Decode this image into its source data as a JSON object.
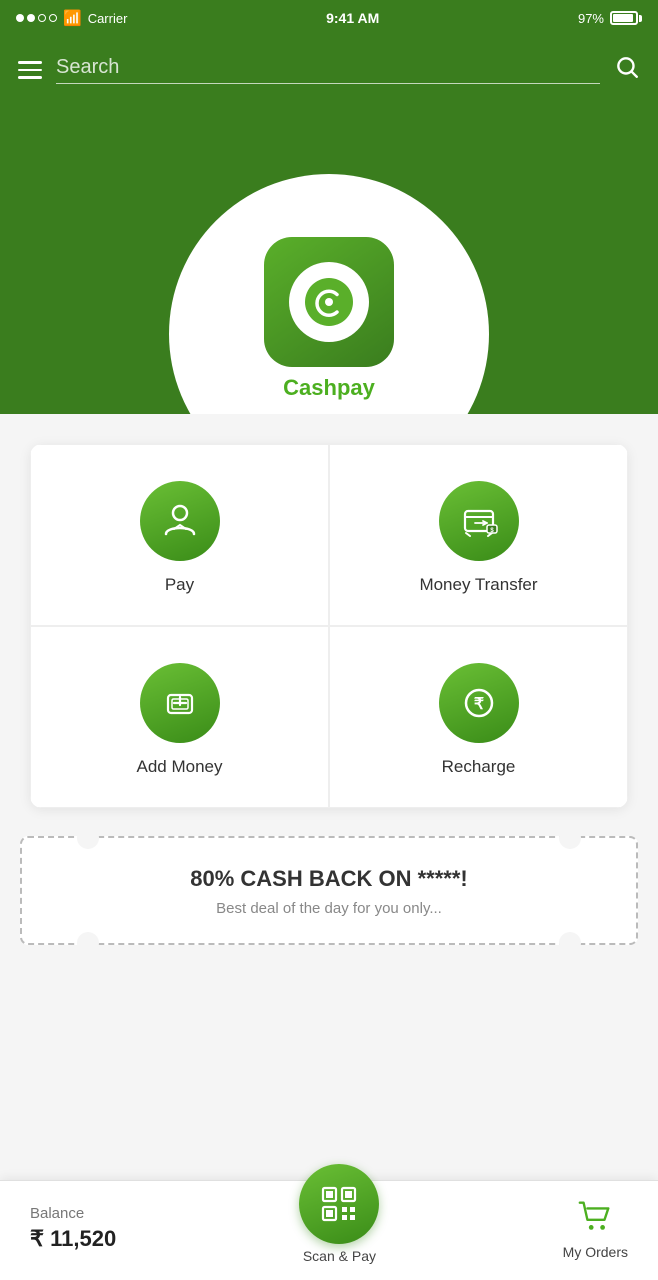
{
  "statusBar": {
    "carrier": "Carrier",
    "time": "9:41 AM",
    "battery": "97%"
  },
  "searchBar": {
    "placeholder": "Search"
  },
  "hero": {
    "appName": "Cashpay"
  },
  "grid": {
    "items": [
      {
        "id": "pay",
        "label": "Pay",
        "icon": "pay"
      },
      {
        "id": "money-transfer",
        "label": "Money Transfer",
        "icon": "money-transfer"
      },
      {
        "id": "add-money",
        "label": "Add Money",
        "icon": "add-money"
      },
      {
        "id": "recharge",
        "label": "Recharge",
        "icon": "recharge"
      }
    ]
  },
  "promo": {
    "title": "80% CASH BACK ON *****!",
    "subtitle": "Best deal of the day for you only..."
  },
  "bottomBar": {
    "balance": {
      "label": "Balance",
      "amount": "₹ 11,520"
    },
    "scanPay": {
      "label": "Scan & Pay"
    },
    "myOrders": {
      "label": "My Orders"
    }
  }
}
